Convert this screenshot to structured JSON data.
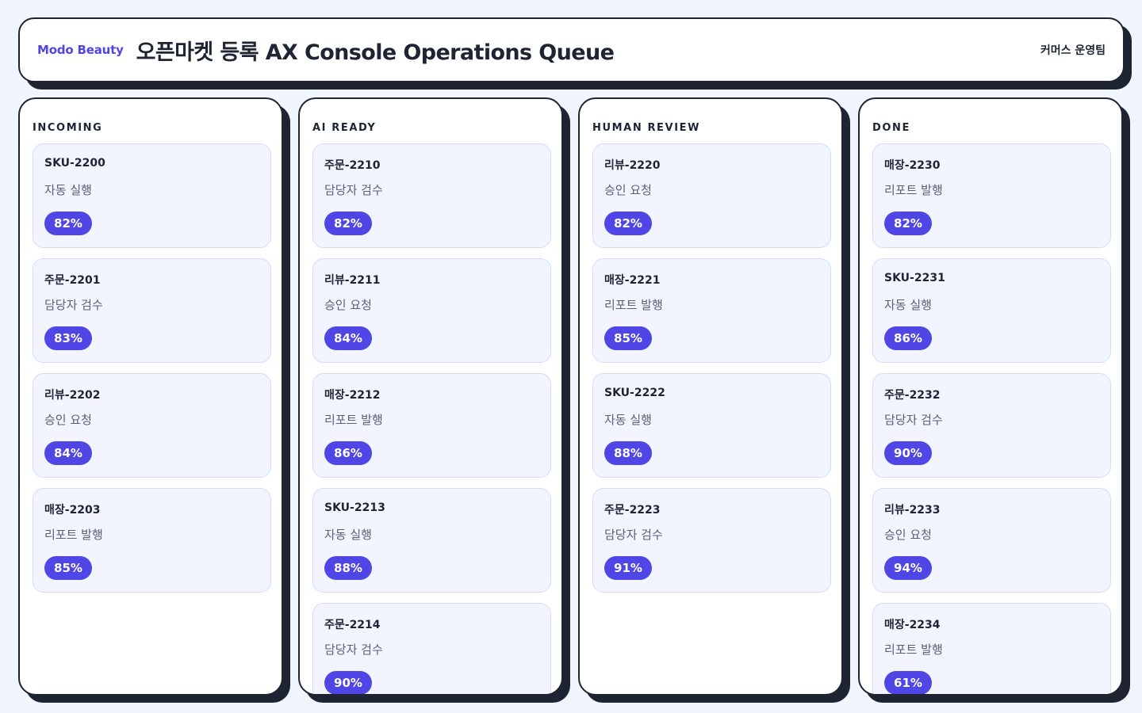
{
  "header": {
    "brand": "Modo Beauty",
    "title": "오픈마켓 등록 AX Console Operations Queue",
    "team": "커머스 운영팀"
  },
  "colors": {
    "accent": "#4f46e5",
    "ink": "#1f2433",
    "card_bg": "#f2f5ff",
    "page_bg": "#f1f5fd"
  },
  "columns": [
    {
      "title": "INCOMING",
      "cards": [
        {
          "id": "SKU-2200",
          "status": "자동 실행",
          "score": "82%"
        },
        {
          "id": "주문-2201",
          "status": "담당자 검수",
          "score": "83%"
        },
        {
          "id": "리뷰-2202",
          "status": "승인 요청",
          "score": "84%"
        },
        {
          "id": "매장-2203",
          "status": "리포트 발행",
          "score": "85%"
        }
      ]
    },
    {
      "title": "AI READY",
      "cards": [
        {
          "id": "주문-2210",
          "status": "담당자 검수",
          "score": "82%"
        },
        {
          "id": "리뷰-2211",
          "status": "승인 요청",
          "score": "84%"
        },
        {
          "id": "매장-2212",
          "status": "리포트 발행",
          "score": "86%"
        },
        {
          "id": "SKU-2213",
          "status": "자동 실행",
          "score": "88%"
        },
        {
          "id": "주문-2214",
          "status": "담당자 검수",
          "score": "90%"
        }
      ]
    },
    {
      "title": "HUMAN REVIEW",
      "cards": [
        {
          "id": "리뷰-2220",
          "status": "승인 요청",
          "score": "82%"
        },
        {
          "id": "매장-2221",
          "status": "리포트 발행",
          "score": "85%"
        },
        {
          "id": "SKU-2222",
          "status": "자동 실행",
          "score": "88%"
        },
        {
          "id": "주문-2223",
          "status": "담당자 검수",
          "score": "91%"
        }
      ]
    },
    {
      "title": "DONE",
      "cards": [
        {
          "id": "매장-2230",
          "status": "리포트 발행",
          "score": "82%"
        },
        {
          "id": "SKU-2231",
          "status": "자동 실행",
          "score": "86%"
        },
        {
          "id": "주문-2232",
          "status": "담당자 검수",
          "score": "90%"
        },
        {
          "id": "리뷰-2233",
          "status": "승인 요청",
          "score": "94%"
        },
        {
          "id": "매장-2234",
          "status": "리포트 발행",
          "score": "61%"
        }
      ]
    }
  ]
}
